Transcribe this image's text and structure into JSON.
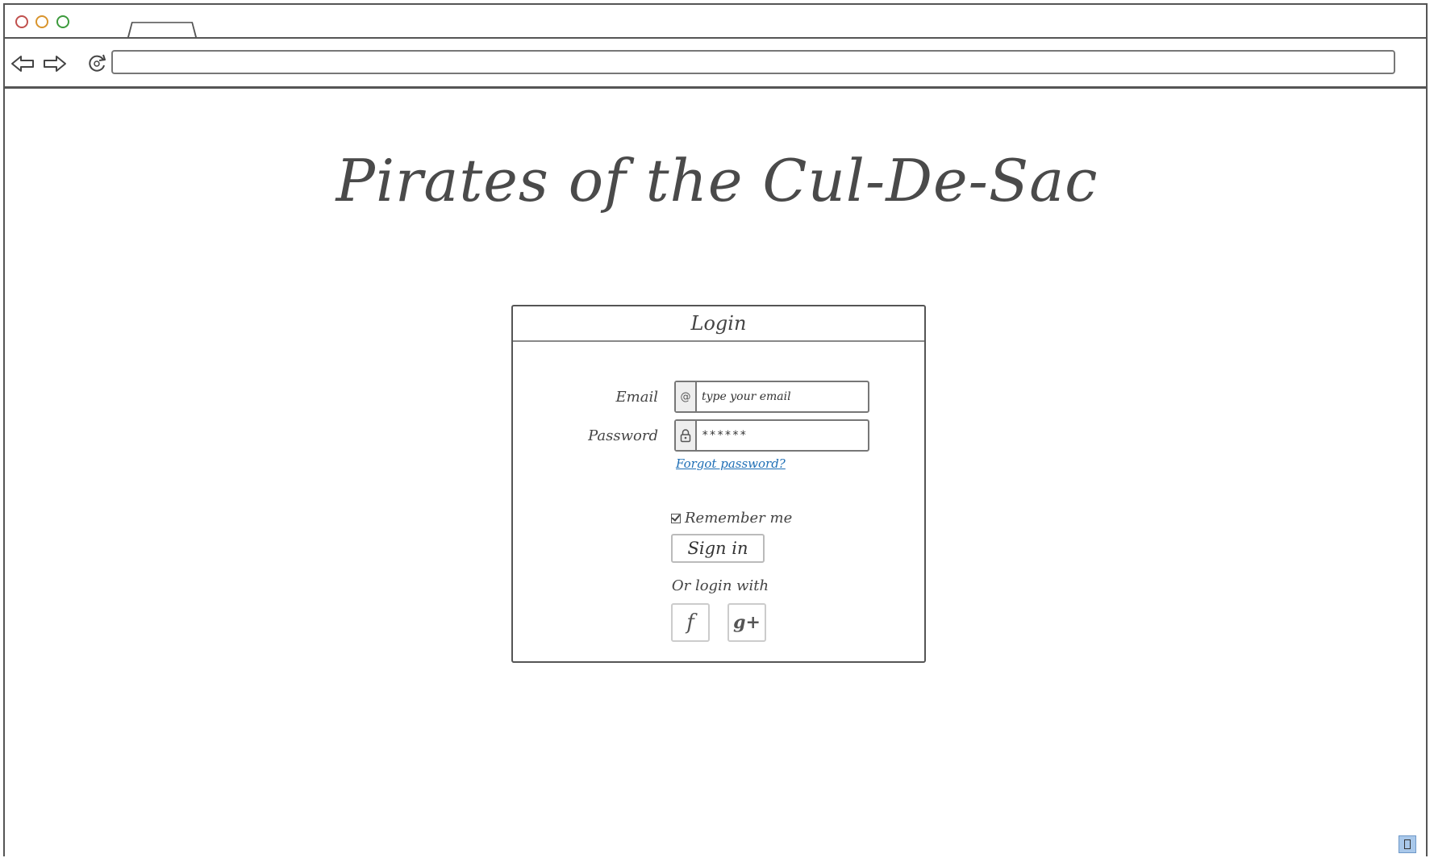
{
  "site": {
    "title": "Pirates of the Cul-De-Sac"
  },
  "login": {
    "header": "Login",
    "email_label": "Email",
    "email_placeholder": "type your email",
    "password_label": "Password",
    "password_value": "******",
    "forgot_link": "Forgot password?",
    "remember_label": "Remember me",
    "remember_checked": true,
    "signin_label": "Sign in",
    "or_login_with": "Or login with",
    "social": [
      {
        "name": "facebook",
        "glyph": "f"
      },
      {
        "name": "google-plus",
        "glyph": "g+"
      }
    ]
  },
  "icons": {
    "email_addon": "at-icon",
    "password_addon": "lock-icon"
  },
  "colors": {
    "link": "#1f6fb6",
    "close_dot": "#c0504d",
    "minimize_dot": "#d9942c",
    "maximize_dot": "#3c9a3c"
  }
}
